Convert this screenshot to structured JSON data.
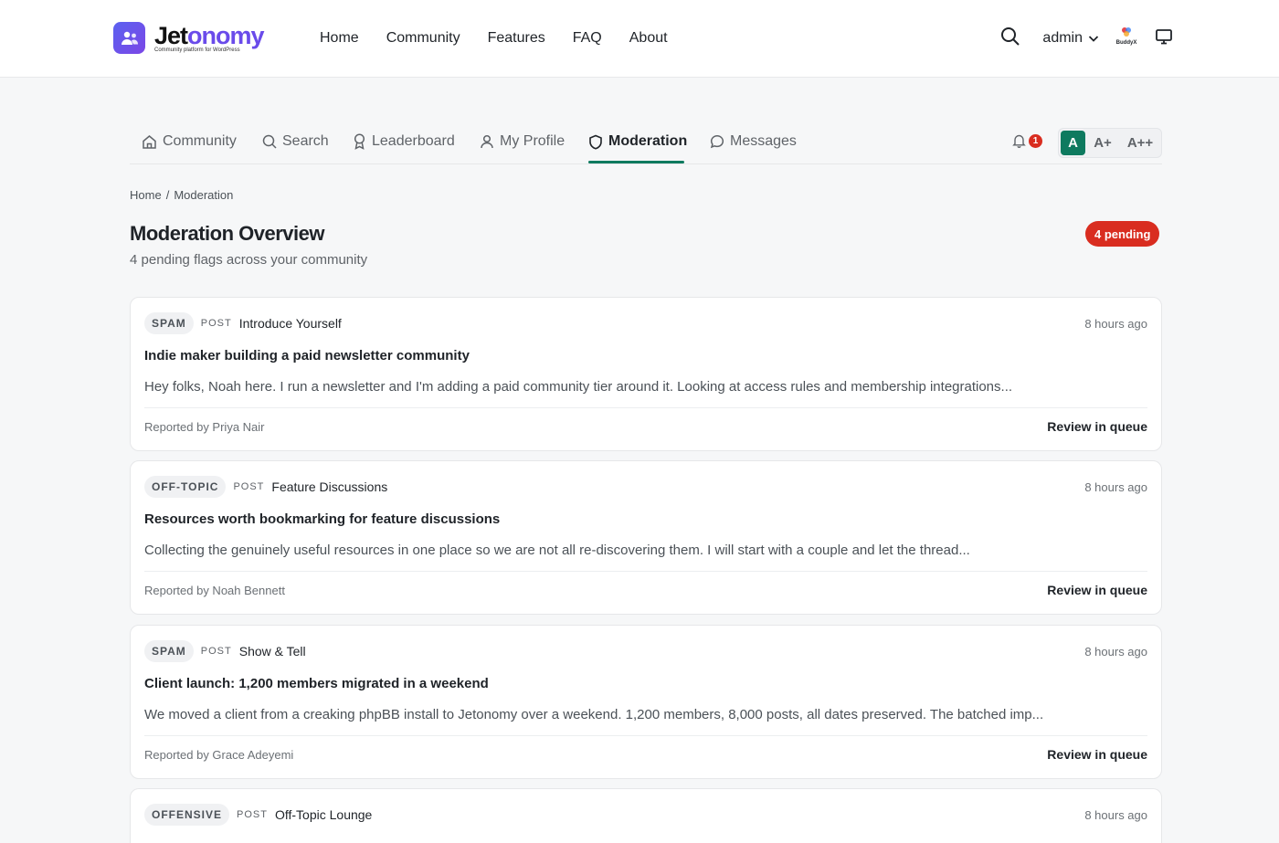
{
  "brand": {
    "name_a": "Jet",
    "name_b": "onomy",
    "tagline": "Community platform for WordPress",
    "buddyx_label": "BuddyX"
  },
  "nav": {
    "items": [
      "Home",
      "Community",
      "Features",
      "FAQ",
      "About"
    ]
  },
  "user": {
    "name": "admin"
  },
  "tabs": [
    {
      "label": "Community",
      "icon": "home-icon"
    },
    {
      "label": "Search",
      "icon": "search-icon"
    },
    {
      "label": "Leaderboard",
      "icon": "medal-icon"
    },
    {
      "label": "My Profile",
      "icon": "user-icon"
    },
    {
      "label": "Moderation",
      "icon": "shield-icon",
      "active": true
    },
    {
      "label": "Messages",
      "icon": "chat-icon"
    }
  ],
  "notifications": {
    "count": "1"
  },
  "font_size": {
    "options": [
      "A",
      "A+",
      "A++"
    ],
    "selected": "A"
  },
  "breadcrumb": {
    "home": "Home",
    "separator": "/",
    "current": "Moderation"
  },
  "page": {
    "title": "Moderation Overview",
    "subtitle": "4 pending flags across your community",
    "pending_badge": "4 pending"
  },
  "flags": [
    {
      "reason": "SPAM",
      "kind": "POST",
      "space": "Introduce Yourself",
      "time": "8 hours ago",
      "title": "Indie maker building a paid newsletter community",
      "excerpt": "Hey folks, Noah here. I run a newsletter and I'm adding a paid community tier around it. Looking at access rules and membership integrations...",
      "reported_by": "Reported by Priya Nair",
      "action": "Review in queue"
    },
    {
      "reason": "OFF-TOPIC",
      "kind": "POST",
      "space": "Feature Discussions",
      "time": "8 hours ago",
      "title": "Resources worth bookmarking for feature discussions",
      "excerpt": "Collecting the genuinely useful resources in one place so we are not all re-discovering them. I will start with a couple and let the thread...",
      "reported_by": "Reported by Noah Bennett",
      "action": "Review in queue"
    },
    {
      "reason": "SPAM",
      "kind": "POST",
      "space": "Show & Tell",
      "time": "8 hours ago",
      "title": "Client launch: 1,200 members migrated in a weekend",
      "excerpt": "We moved a client from a creaking phpBB install to Jetonomy over a weekend. 1,200 members, 8,000 posts, all dates preserved. The batched imp...",
      "reported_by": "Reported by Grace Adeyemi",
      "action": "Review in queue"
    },
    {
      "reason": "OFFENSIVE",
      "kind": "POST",
      "space": "Off-Topic Lounge",
      "time": "8 hours ago",
      "title": "",
      "excerpt": "",
      "reported_by": "",
      "action": ""
    }
  ],
  "colors": {
    "accent": "#0e7a5f",
    "danger": "#d92d20",
    "brand": "#6a4bea"
  }
}
